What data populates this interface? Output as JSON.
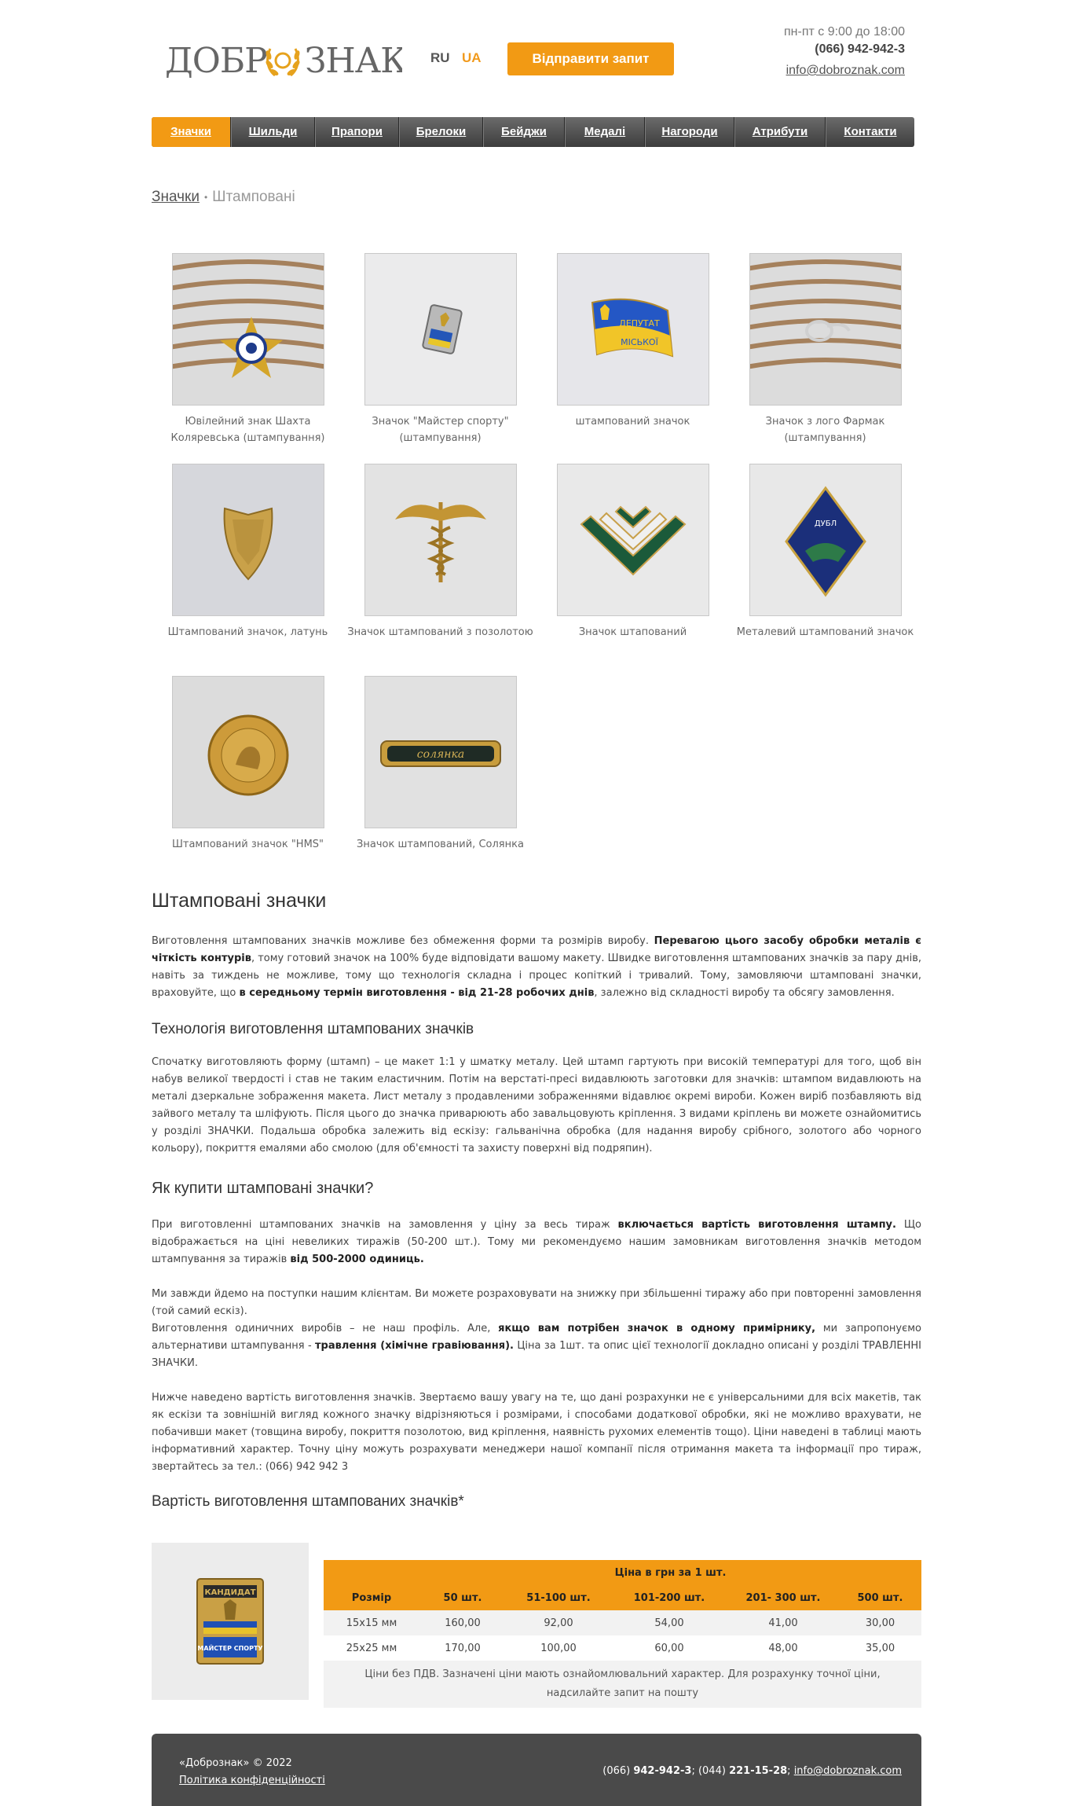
{
  "header": {
    "logo_text": "ДОБРОЗНАК",
    "lang_ru": "RU",
    "lang_ua": "UA",
    "cta_label": "Відправити запит",
    "hours": "пн-пт с 9:00 до 18:00",
    "phone": "(066) 942-942-3",
    "email": "info@dobroznak.com"
  },
  "nav": {
    "items": [
      "Значки",
      "Шильди",
      "Прапори",
      "Брелоки",
      "Бейджи",
      "Медалі",
      "Нагороди",
      "Атрибути",
      "Контакти"
    ],
    "active": "Значки"
  },
  "breadcrumb": {
    "parent": "Значки",
    "current": "Штамповані"
  },
  "gallery": [
    {
      "caption": "Ювілейний знак Шахта Коляревська (штампування)",
      "icon": "star-badge-on-twine"
    },
    {
      "caption": "Значок \"Майстер спорту\" (штампування)",
      "icon": "master-sport-badge"
    },
    {
      "caption": "штампований значок",
      "icon": "flag-badge"
    },
    {
      "caption": "Значок з лого Фармак (штампування)",
      "icon": "silver-logo-on-twine"
    },
    {
      "caption": "Штампований значок, латунь",
      "icon": "brass-shield-badge"
    },
    {
      "caption": "Значок штампований з позолотою",
      "icon": "caduceus-badge"
    },
    {
      "caption": "Значок штапований",
      "icon": "chevron-badge"
    },
    {
      "caption": "Металевий штампований значок",
      "icon": "rhombus-badge"
    },
    {
      "caption": "Штампований значок \"HMS\"",
      "icon": "round-gold-badge"
    },
    {
      "caption": "Значок штампований, Солянка",
      "icon": "bar-badge"
    }
  ],
  "article": {
    "title": "Штамповані значки",
    "intro": {
      "t1": "Виготовлення штампованих значків можливе без обмеження форми та розмірів виробу. ",
      "b1": "Перевагою цього засобу обробки металів є чіткість контурів",
      "t2": ", тому готовий значок на 100% буде відповідати вашому макету. Швидке виготовлення штампованих значків за пару днів, навіть за тиждень не можливе, тому що технологія складна і процес копіткий і тривалий. Тому, замовляючи штамповані значки, враховуйте, що ",
      "b2": "в середньому термін виготовлення - від 21-28 робочих днів",
      "t3": ", залежно від складності виробу та обсягу замовлення."
    },
    "tech_title": "Технологія виготовлення штампованих значків",
    "tech_text": "Спочатку виготовляють форму (штамп) – це макет 1:1 у шматку металу. Цей штамп гартують при високій температурі для того, щоб він набув великої твердості і став не таким еластичним. Потім на верстаті-пресі видавлюють заготовки для значків: штампом видавлюють на металі дзеркальне зображення макета. Лист металу з продавленими зображеннями відавлює окремі вироби. Кожен виріб позбавляють від зайвого металу та шліфують. Після цього до значка приварюють або завальцовують кріплення. З видами кріплень ви можете ознайомитись у розділі ЗНАЧКИ. Подальша обробка залежить від ескізу: гальванічна обробка (для надання виробу срібного, золотого або чорного кольору), покриття емалями або смолою (для об'ємності та захисту поверхні від подряпин).",
    "buy_title": "Як купити штамповані значки?",
    "buy_p1": {
      "t1": "При виготовленні штампованих значків на замовлення у ціну за весь тираж ",
      "b1": "включається вартість виготовлення штампу.",
      "t2": " Що відображається на ціні невеликих тиражів (50-200 шт.). Тому ми рекомендуємо нашим замовникам виготовлення значків методом штампування за тиражів ",
      "b2": "від 500-2000 одиниць."
    },
    "buy_p2": "Ми завжди йдемо на поступки нашим клієнтам. Ви можете розраховувати на знижку при збільшенні тиражу або при повторенні замовлення (той самий ескіз).",
    "buy_p3": {
      "t1": "Виготовлення одиничних виробів – не наш профіль. Але, ",
      "b1": "якщо вам потрібен значок в одному примірнику,",
      "t2": " ми запропонуємо альтернативи штампування - ",
      "b2": "травлення (хімічне гравіювання).",
      "t3": " Ціна за 1шт. та опис цієї технології докладно описані у розділі ТРАВЛЕННІ ЗНАЧКИ."
    },
    "buy_p4": "Нижче наведено вартість виготовлення значків. Звертаємо вашу увагу на те, що дані розрахунки не є універсальними для всіх макетів, так як ескізи та зовнішній вигляд кожного значку відрізняються і розмірами, і способами додаткової обробки, які не можливо врахувати, не побачивши макет (товщина виробу, покриття позолотою, вид кріплення, наявність рухомих елементів тощо). Ціни наведені в таблиці мають інформативний характер. Точну ціну можуть розрахувати менеджери нашої компанії після отримання макета та інформації про тираж, звертайтесь за тел.: (066) 942 942 3",
    "price_title": "Вартість виготовлення штампованих значків*"
  },
  "price_table": {
    "header_top": "Ціна в грн за 1 шт.",
    "columns": [
      "Розмір",
      "50 шт.",
      "51-100 шт.",
      "101-200 шт.",
      "201- 300 шт.",
      "500 шт."
    ],
    "rows": [
      [
        "15х15 мм",
        "160,00",
        "92,00",
        "54,00",
        "41,00",
        "30,00"
      ],
      [
        "25х25 мм",
        "170,00",
        "100,00",
        "60,00",
        "48,00",
        "35,00"
      ]
    ],
    "note": "Ціни без ПДВ. Зазначені ціни мають ознайомлювальний характер. Для розрахунку точної ціни, надсилайте запит на пошту",
    "image_badge_top": "КАНДИДАТ",
    "image_badge_bottom": "МАЙСТЕР СПОРТУ"
  },
  "footer": {
    "copyright": "«Добрознак» © 2022",
    "policy": "Політика конфіденційності",
    "phone1_prefix": "(066) ",
    "phone1": "942-942-3",
    "sep": "; (044) ",
    "phone2": "221-15-28",
    "email": "info@dobroznak.com"
  },
  "colors": {
    "accent": "#f29a14",
    "nav_dark": "#4a4a4a",
    "footer": "#4a4a4a"
  }
}
